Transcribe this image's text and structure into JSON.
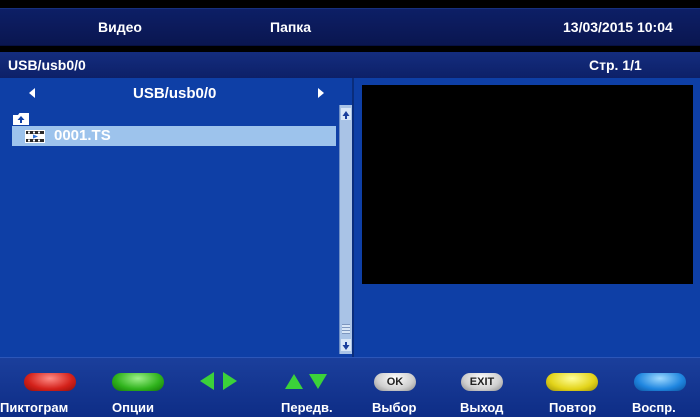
{
  "header": {
    "section": "Видео",
    "folder": "Папка",
    "datetime": "13/03/2015 10:04"
  },
  "pathbar": {
    "path": "USB/usb0/0",
    "page": "Стр. 1/1"
  },
  "browser": {
    "current_dir": "USB/usb0/0",
    "items": [
      {
        "name": "0001.TS",
        "type": "video",
        "selected": true
      }
    ]
  },
  "footer": {
    "labels": {
      "red": "Пиктограмм",
      "green": "Опции",
      "updown": "Передв.",
      "ok": "Выбор",
      "exit": "Выход",
      "yellow": "Повтор",
      "blue": "Воспр."
    },
    "key_text": {
      "ok": "OK",
      "exit": "EXIT"
    }
  },
  "colors": {
    "panel_bg": "#0e3fa6",
    "selection": "#9dc3ec",
    "red_key": "#d4211a",
    "green_key": "#2fb31c",
    "yellow_key": "#e3d41a",
    "blue_key": "#1f86e0",
    "arrow_keys": "#3bd23a"
  }
}
